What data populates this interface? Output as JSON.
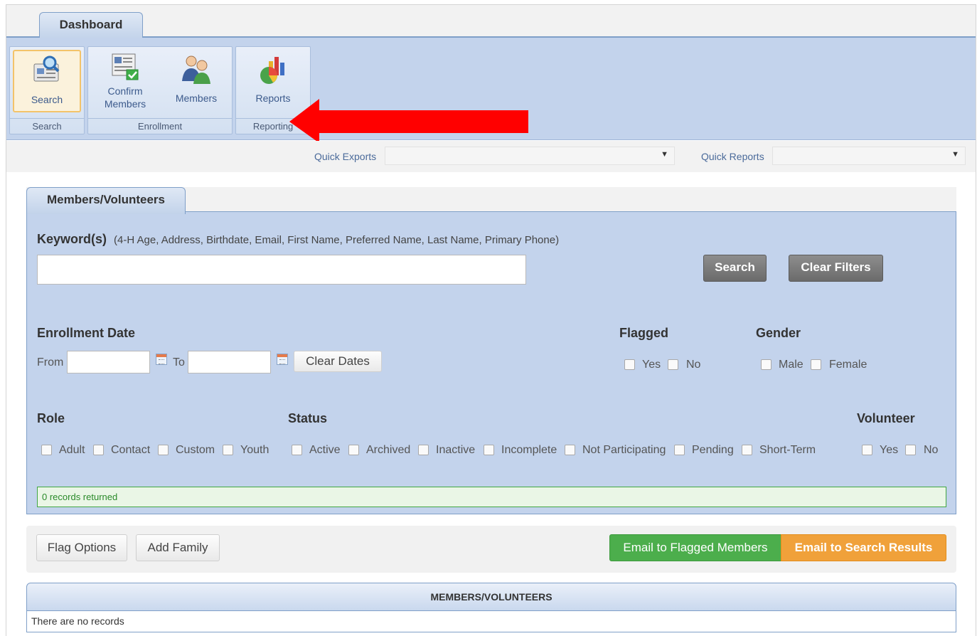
{
  "tabs": {
    "dashboard": "Dashboard"
  },
  "ribbon": {
    "search_btn": "Search",
    "search_group": "Search",
    "confirm_btn_line1": "Confirm",
    "confirm_btn_line2": "Members",
    "members_btn": "Members",
    "enrollment_group": "Enrollment",
    "reports_btn": "Reports",
    "reporting_group": "Reporting"
  },
  "quickbar": {
    "exports_label": "Quick Exports",
    "exports_value": "",
    "reports_label": "Quick Reports",
    "reports_value": ""
  },
  "panel": {
    "tab": "Members/Volunteers",
    "keyword_label": "Keyword(s)",
    "keyword_hint": "(4-H Age, Address, Birthdate, Email, First Name, Preferred Name, Last Name, Primary Phone)",
    "keyword_value": "",
    "search_btn": "Search",
    "clear_filters_btn": "Clear Filters",
    "enrollment_date": "Enrollment Date",
    "from": "From",
    "to": "To",
    "clear_dates": "Clear Dates",
    "flagged": "Flagged",
    "flagged_yes": "Yes",
    "flagged_no": "No",
    "gender": "Gender",
    "gender_male": "Male",
    "gender_female": "Female",
    "role": "Role",
    "role_items": [
      "Adult",
      "Contact",
      "Custom",
      "Youth"
    ],
    "status": "Status",
    "status_items": [
      "Active",
      "Archived",
      "Inactive",
      "Incomplete",
      "Not Participating",
      "Pending",
      "Short-Term"
    ],
    "volunteer": "Volunteer",
    "volunteer_yes": "Yes",
    "volunteer_no": "No",
    "records": "0 records returned"
  },
  "actions": {
    "flag_options": "Flag Options",
    "add_family": "Add Family",
    "email_flagged": "Email to Flagged Members",
    "email_results": "Email to Search Results"
  },
  "grid": {
    "header": "MEMBERS/VOLUNTEERS",
    "empty": "There are no records"
  },
  "colors": {
    "ribbon": "#c3d3ec",
    "accent_arrow": "#ff0000",
    "green": "#4cae4c",
    "orange": "#f0a13a"
  },
  "icons": [
    "search-icon",
    "confirm-members-icon",
    "members-icon",
    "reports-icon",
    "calendar-icon",
    "dropdown-caret-icon",
    "red-arrow-icon"
  ]
}
